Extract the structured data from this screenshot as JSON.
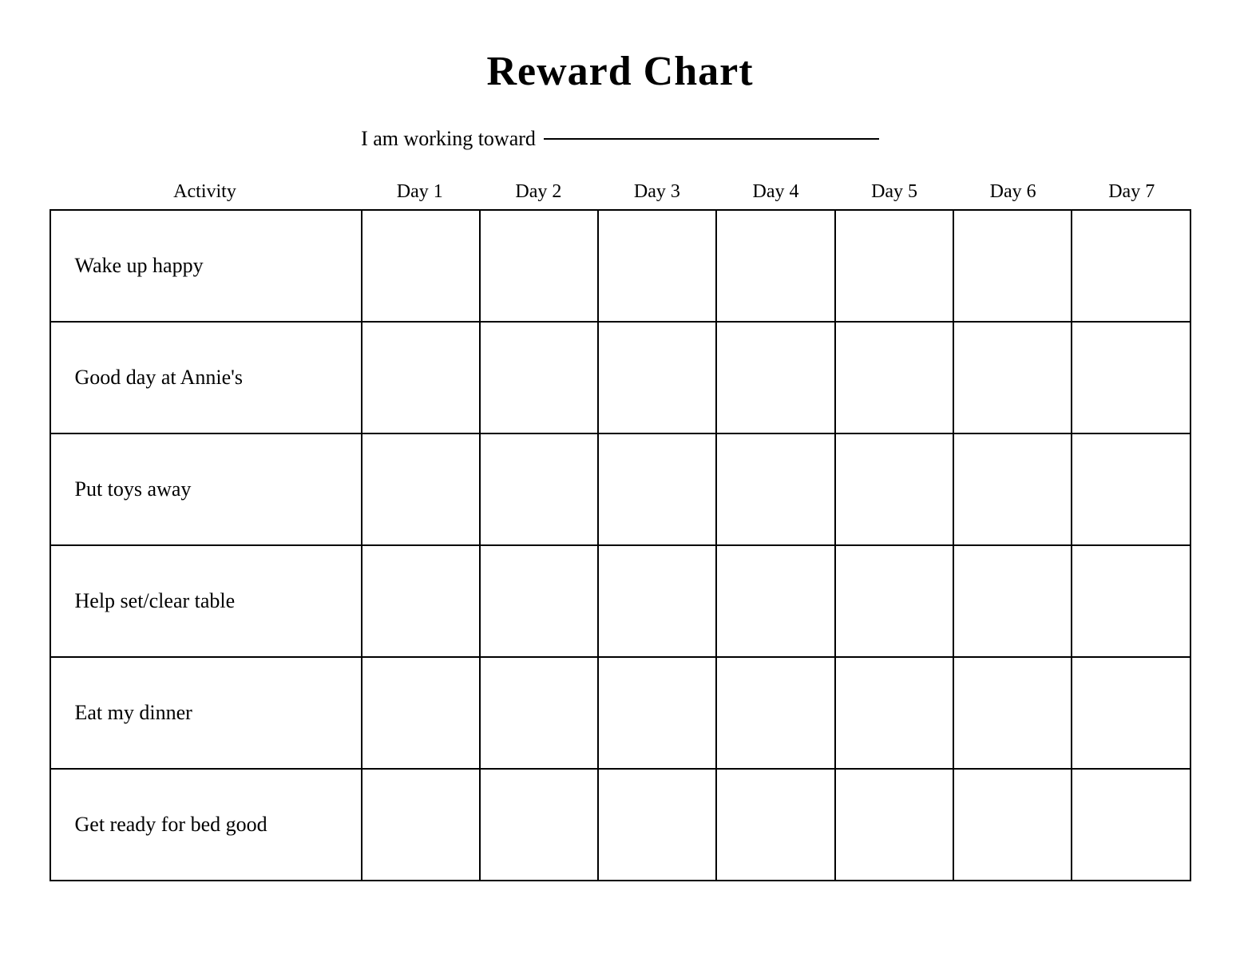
{
  "title": "Reward Chart",
  "subtitle": {
    "label": "I am working toward",
    "line_placeholder": ""
  },
  "columns": {
    "activity_header": "Activity",
    "day_headers": [
      "Day 1",
      "Day 2",
      "Day 3",
      "Day 4",
      "Day 5",
      "Day 6",
      "Day 7"
    ]
  },
  "rows": [
    {
      "activity": "Wake up happy"
    },
    {
      "activity": "Good day at Annie's"
    },
    {
      "activity": "Put toys away"
    },
    {
      "activity": "Help set/clear table"
    },
    {
      "activity": "Eat my dinner"
    },
    {
      "activity": "Get ready for bed good"
    }
  ]
}
